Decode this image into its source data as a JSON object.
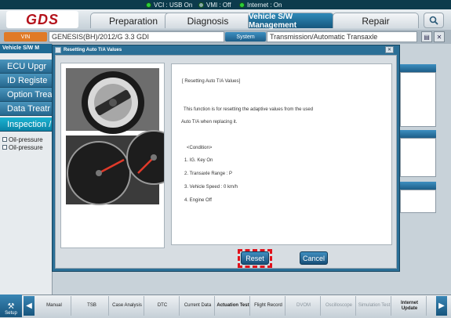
{
  "status": {
    "vci": "VCI : USB On",
    "vmi": "VMI : Off",
    "internet": "Internet : On"
  },
  "header": {
    "logo": "GDS",
    "tabs": [
      {
        "label": "Preparation"
      },
      {
        "label": "Diagnosis"
      },
      {
        "label": "Vehicle S/W Management"
      },
      {
        "label": "Repair"
      }
    ],
    "search_icon": "magnifier"
  },
  "vehicle_bar": {
    "vin_label": "VIN",
    "vehicle": "GENESIS(BH)/2012/G 3.3 GDI",
    "system_label": "System",
    "system": "Transmission/Automatic Transaxle"
  },
  "sidebar": {
    "title": "Vehicle S/W M",
    "items": [
      {
        "label": "ECU Upgr"
      },
      {
        "label": "ID Registe"
      },
      {
        "label": "Option Treat"
      },
      {
        "label": "Data Treatr"
      },
      {
        "label": "Inspection /"
      }
    ],
    "sub_items": [
      {
        "label": "Oil-pressure"
      },
      {
        "label": "Oil-pressure"
      }
    ]
  },
  "dialog": {
    "title": "Resetting Auto T/A Values",
    "heading": "[ Resetting Auto T/A Values]",
    "description_1": "This function is for resetting the adaptive values from the used",
    "description_2": "Auto T/A when replacing it.",
    "condition_title": "<Condition>",
    "conditions": [
      "1. IG. Key On",
      "2. Transaxle Range : P",
      "3. Vehicle Speed : 0 km/h",
      "4. Engine Off"
    ],
    "reset_label": "Reset",
    "cancel_label": "Cancel"
  },
  "toolbar": {
    "setup_label": "Setup",
    "items": [
      {
        "label": "Manual"
      },
      {
        "label": "TSB"
      },
      {
        "label": "Case Analysis"
      },
      {
        "label": "DTC"
      },
      {
        "label": "Current Data"
      },
      {
        "label": "Actuation Test"
      },
      {
        "label": "Flight Record"
      },
      {
        "label": "DVOM"
      },
      {
        "label": "Oscilloscope"
      },
      {
        "label": "Simulation Test"
      },
      {
        "label": "Internet Update"
      }
    ]
  },
  "colors": {
    "accent": "#1e6a94",
    "highlight": "#e0121b",
    "vin_orange": "#e07a26"
  }
}
